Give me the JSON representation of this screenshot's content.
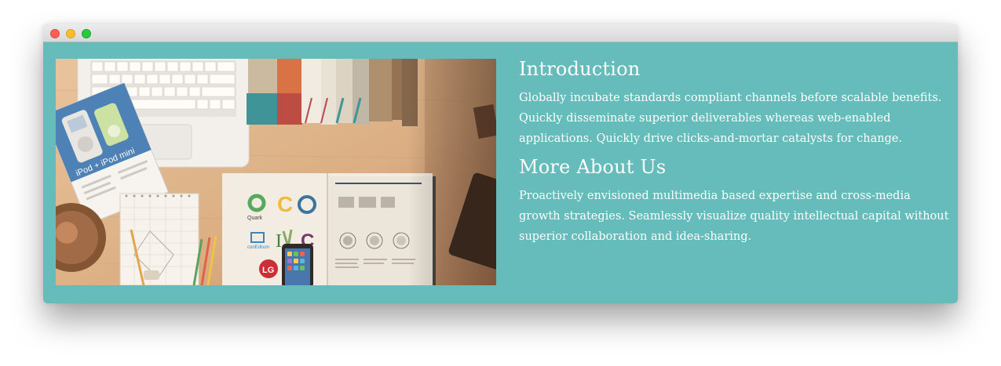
{
  "window": {
    "controls": [
      "close",
      "minimize",
      "maximize"
    ]
  },
  "image": {
    "description_icons": [
      "laptop-keyboard",
      "ipod-brochure",
      "books",
      "open-magazine",
      "notepad",
      "pencils",
      "smartphone",
      "tablet"
    ],
    "logo_texts": [
      "iPod",
      "iPod mini",
      "Quark",
      "conEdison",
      "LG"
    ]
  },
  "sections": [
    {
      "heading": "Introduction",
      "body": "Globally incubate standards compliant channels before scalable benefits. Quickly disseminate superior deliverables whereas web-enabled applications. Quickly drive clicks-and-mortar catalysts for change."
    },
    {
      "heading": "More About Us",
      "body": "Proactively envisioned multimedia based expertise and cross-media growth strategies. Seamlessly visualize quality intellectual capital without superior collaboration and idea-sharing."
    }
  ],
  "colors": {
    "background": "#66bbbb",
    "text": "#ffffff",
    "titlebar": "#e3e3e3"
  }
}
